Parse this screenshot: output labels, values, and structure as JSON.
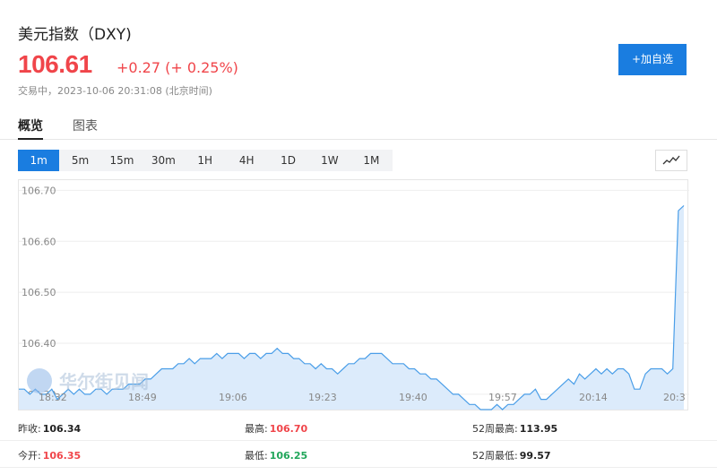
{
  "header": {
    "title": "美元指数（DXY)",
    "price": "106.61",
    "change": "+0.27 (+ 0.25%)",
    "status": "交易中，2023-10-06 20:31:08 (北京时间)",
    "add_button": "+加自选"
  },
  "tabs": [
    {
      "label": "概览",
      "active": true
    },
    {
      "label": "图表",
      "active": false
    }
  ],
  "periods": [
    {
      "label": "1m",
      "active": true
    },
    {
      "label": "5m",
      "active": false
    },
    {
      "label": "15m",
      "active": false
    },
    {
      "label": "30m",
      "active": false
    },
    {
      "label": "1H",
      "active": false
    },
    {
      "label": "4H",
      "active": false
    },
    {
      "label": "1D",
      "active": false
    },
    {
      "label": "1W",
      "active": false
    },
    {
      "label": "1M",
      "active": false
    }
  ],
  "chart_type_icon": "line-chart-icon",
  "watermark": "华尔街见闻",
  "colors": {
    "accent": "#1a7de0",
    "up": "#f0454a",
    "down": "#21a65a",
    "line": "#4a9ee8",
    "fill": "#dcebfb"
  },
  "chart_data": {
    "type": "area",
    "y_ticks": [
      "106.70",
      "106.60",
      "106.50",
      "106.40",
      "106.30"
    ],
    "x_ticks": [
      "18:32",
      "18:49",
      "19:06",
      "19:23",
      "19:40",
      "19:57",
      "20:14",
      "20:3"
    ],
    "ylim": [
      106.27,
      106.72
    ],
    "values": [
      106.31,
      106.31,
      106.3,
      106.31,
      106.3,
      106.3,
      106.31,
      106.29,
      106.3,
      106.31,
      106.3,
      106.31,
      106.3,
      106.3,
      106.31,
      106.31,
      106.3,
      106.31,
      106.31,
      106.31,
      106.32,
      106.32,
      106.32,
      106.33,
      106.33,
      106.34,
      106.35,
      106.35,
      106.35,
      106.36,
      106.36,
      106.37,
      106.36,
      106.37,
      106.37,
      106.37,
      106.38,
      106.37,
      106.38,
      106.38,
      106.38,
      106.37,
      106.38,
      106.38,
      106.37,
      106.38,
      106.38,
      106.39,
      106.38,
      106.38,
      106.37,
      106.37,
      106.36,
      106.36,
      106.35,
      106.36,
      106.35,
      106.35,
      106.34,
      106.35,
      106.36,
      106.36,
      106.37,
      106.37,
      106.38,
      106.38,
      106.38,
      106.37,
      106.36,
      106.36,
      106.36,
      106.35,
      106.35,
      106.34,
      106.34,
      106.33,
      106.33,
      106.32,
      106.31,
      106.3,
      106.3,
      106.29,
      106.28,
      106.28,
      106.27,
      106.27,
      106.27,
      106.28,
      106.27,
      106.28,
      106.28,
      106.29,
      106.3,
      106.3,
      106.31,
      106.29,
      106.29,
      106.3,
      106.31,
      106.32,
      106.33,
      106.32,
      106.34,
      106.33,
      106.34,
      106.35,
      106.34,
      106.35,
      106.34,
      106.35,
      106.35,
      106.34,
      106.31,
      106.31,
      106.34,
      106.35,
      106.35,
      106.35,
      106.34,
      106.35,
      106.66,
      106.67
    ]
  },
  "stats": {
    "row1": [
      {
        "label": "昨收:",
        "value": "106.34",
        "color": "black"
      },
      {
        "label": "最高:",
        "value": "106.70",
        "color": "red"
      },
      {
        "label": "52周最高:",
        "value": "113.95",
        "color": "black"
      }
    ],
    "row2": [
      {
        "label": "今开:",
        "value": "106.35",
        "color": "red"
      },
      {
        "label": "最低:",
        "value": "106.25",
        "color": "green"
      },
      {
        "label": "52周最低:",
        "value": "99.57",
        "color": "black"
      }
    ]
  }
}
